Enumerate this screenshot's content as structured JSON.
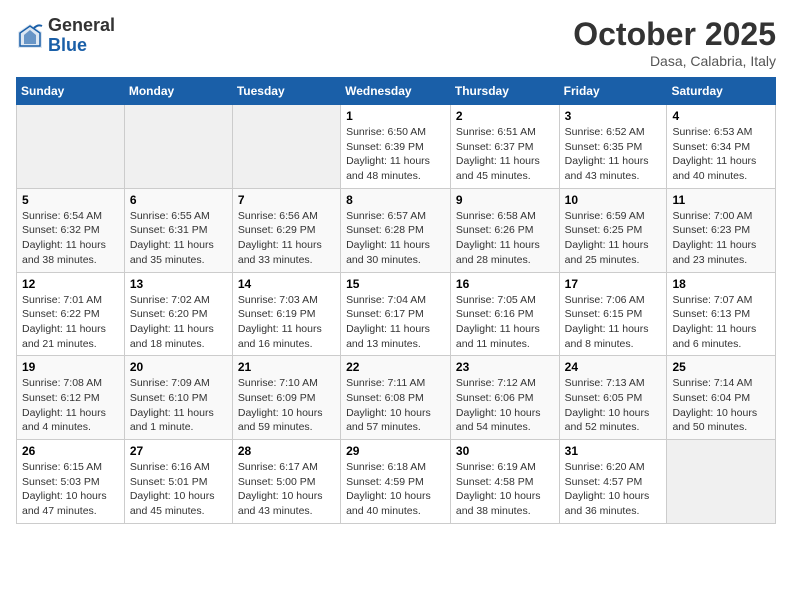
{
  "header": {
    "logo_general": "General",
    "logo_blue": "Blue",
    "month": "October 2025",
    "location": "Dasa, Calabria, Italy"
  },
  "days_of_week": [
    "Sunday",
    "Monday",
    "Tuesday",
    "Wednesday",
    "Thursday",
    "Friday",
    "Saturday"
  ],
  "weeks": [
    [
      {
        "day": "",
        "info": ""
      },
      {
        "day": "",
        "info": ""
      },
      {
        "day": "",
        "info": ""
      },
      {
        "day": "1",
        "info": "Sunrise: 6:50 AM\nSunset: 6:39 PM\nDaylight: 11 hours\nand 48 minutes."
      },
      {
        "day": "2",
        "info": "Sunrise: 6:51 AM\nSunset: 6:37 PM\nDaylight: 11 hours\nand 45 minutes."
      },
      {
        "day": "3",
        "info": "Sunrise: 6:52 AM\nSunset: 6:35 PM\nDaylight: 11 hours\nand 43 minutes."
      },
      {
        "day": "4",
        "info": "Sunrise: 6:53 AM\nSunset: 6:34 PM\nDaylight: 11 hours\nand 40 minutes."
      }
    ],
    [
      {
        "day": "5",
        "info": "Sunrise: 6:54 AM\nSunset: 6:32 PM\nDaylight: 11 hours\nand 38 minutes."
      },
      {
        "day": "6",
        "info": "Sunrise: 6:55 AM\nSunset: 6:31 PM\nDaylight: 11 hours\nand 35 minutes."
      },
      {
        "day": "7",
        "info": "Sunrise: 6:56 AM\nSunset: 6:29 PM\nDaylight: 11 hours\nand 33 minutes."
      },
      {
        "day": "8",
        "info": "Sunrise: 6:57 AM\nSunset: 6:28 PM\nDaylight: 11 hours\nand 30 minutes."
      },
      {
        "day": "9",
        "info": "Sunrise: 6:58 AM\nSunset: 6:26 PM\nDaylight: 11 hours\nand 28 minutes."
      },
      {
        "day": "10",
        "info": "Sunrise: 6:59 AM\nSunset: 6:25 PM\nDaylight: 11 hours\nand 25 minutes."
      },
      {
        "day": "11",
        "info": "Sunrise: 7:00 AM\nSunset: 6:23 PM\nDaylight: 11 hours\nand 23 minutes."
      }
    ],
    [
      {
        "day": "12",
        "info": "Sunrise: 7:01 AM\nSunset: 6:22 PM\nDaylight: 11 hours\nand 21 minutes."
      },
      {
        "day": "13",
        "info": "Sunrise: 7:02 AM\nSunset: 6:20 PM\nDaylight: 11 hours\nand 18 minutes."
      },
      {
        "day": "14",
        "info": "Sunrise: 7:03 AM\nSunset: 6:19 PM\nDaylight: 11 hours\nand 16 minutes."
      },
      {
        "day": "15",
        "info": "Sunrise: 7:04 AM\nSunset: 6:17 PM\nDaylight: 11 hours\nand 13 minutes."
      },
      {
        "day": "16",
        "info": "Sunrise: 7:05 AM\nSunset: 6:16 PM\nDaylight: 11 hours\nand 11 minutes."
      },
      {
        "day": "17",
        "info": "Sunrise: 7:06 AM\nSunset: 6:15 PM\nDaylight: 11 hours\nand 8 minutes."
      },
      {
        "day": "18",
        "info": "Sunrise: 7:07 AM\nSunset: 6:13 PM\nDaylight: 11 hours\nand 6 minutes."
      }
    ],
    [
      {
        "day": "19",
        "info": "Sunrise: 7:08 AM\nSunset: 6:12 PM\nDaylight: 11 hours\nand 4 minutes."
      },
      {
        "day": "20",
        "info": "Sunrise: 7:09 AM\nSunset: 6:10 PM\nDaylight: 11 hours\nand 1 minute."
      },
      {
        "day": "21",
        "info": "Sunrise: 7:10 AM\nSunset: 6:09 PM\nDaylight: 10 hours\nand 59 minutes."
      },
      {
        "day": "22",
        "info": "Sunrise: 7:11 AM\nSunset: 6:08 PM\nDaylight: 10 hours\nand 57 minutes."
      },
      {
        "day": "23",
        "info": "Sunrise: 7:12 AM\nSunset: 6:06 PM\nDaylight: 10 hours\nand 54 minutes."
      },
      {
        "day": "24",
        "info": "Sunrise: 7:13 AM\nSunset: 6:05 PM\nDaylight: 10 hours\nand 52 minutes."
      },
      {
        "day": "25",
        "info": "Sunrise: 7:14 AM\nSunset: 6:04 PM\nDaylight: 10 hours\nand 50 minutes."
      }
    ],
    [
      {
        "day": "26",
        "info": "Sunrise: 6:15 AM\nSunset: 5:03 PM\nDaylight: 10 hours\nand 47 minutes."
      },
      {
        "day": "27",
        "info": "Sunrise: 6:16 AM\nSunset: 5:01 PM\nDaylight: 10 hours\nand 45 minutes."
      },
      {
        "day": "28",
        "info": "Sunrise: 6:17 AM\nSunset: 5:00 PM\nDaylight: 10 hours\nand 43 minutes."
      },
      {
        "day": "29",
        "info": "Sunrise: 6:18 AM\nSunset: 4:59 PM\nDaylight: 10 hours\nand 40 minutes."
      },
      {
        "day": "30",
        "info": "Sunrise: 6:19 AM\nSunset: 4:58 PM\nDaylight: 10 hours\nand 38 minutes."
      },
      {
        "day": "31",
        "info": "Sunrise: 6:20 AM\nSunset: 4:57 PM\nDaylight: 10 hours\nand 36 minutes."
      },
      {
        "day": "",
        "info": ""
      }
    ]
  ]
}
